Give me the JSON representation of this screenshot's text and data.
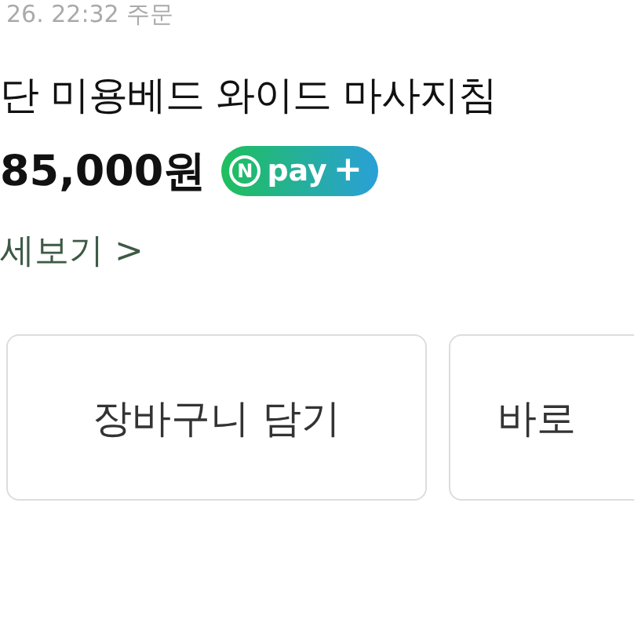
{
  "order_time": "26. 22:32 주문",
  "product_title": "단 미용베드 와이드 마사지침",
  "price": "85,000원",
  "pay_badge": {
    "mark": "N",
    "text": "pay",
    "plus": "+"
  },
  "details_link": {
    "label": "세보기",
    "chevron": ">"
  },
  "buttons": [
    {
      "label": "장바구니 담기"
    },
    {
      "label": "바로"
    }
  ]
}
